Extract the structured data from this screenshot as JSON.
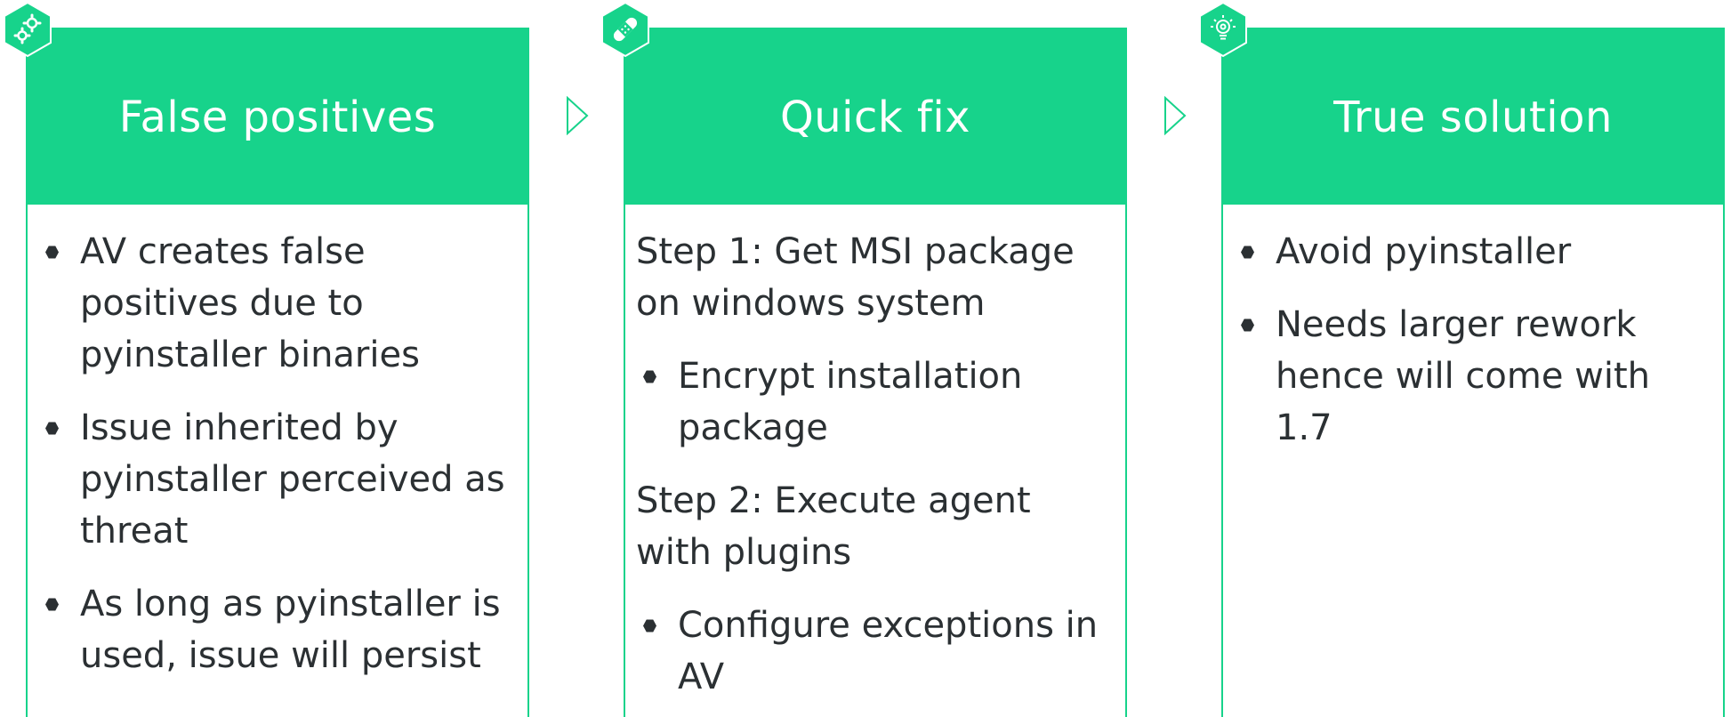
{
  "colors": {
    "accent": "#17d38b",
    "text": "#2b3033",
    "header_text": "#ffffff"
  },
  "panels": [
    {
      "title": "False positives",
      "icon": "gears-icon",
      "bullets": [
        "AV creates false positives due to pyinstaller binaries",
        "Issue inherited by pyinstaller perceived as threat",
        "As long as pyinstaller is used, issue will persist"
      ]
    },
    {
      "title": "Quick fix",
      "icon": "bandage-icon",
      "steps": [
        {
          "label": "Step 1: Get MSI package on windows system",
          "bullet": "Encrypt installation package"
        },
        {
          "label": "Step 2: Execute agent with plugins",
          "bullet": "Configure exceptions in AV"
        }
      ]
    },
    {
      "title": "True solution",
      "icon": "lightbulb-icon",
      "bullets": [
        "Avoid pyinstaller",
        "Needs larger rework hence will come with 1.7"
      ]
    }
  ],
  "arrows": [
    "chevron-right-icon",
    "chevron-right-icon"
  ]
}
